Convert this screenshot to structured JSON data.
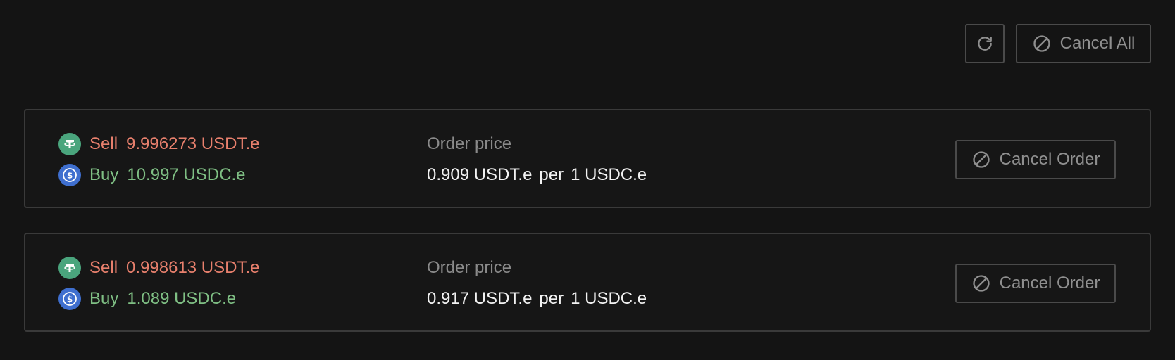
{
  "toolbar": {
    "refresh_icon": "refresh-icon",
    "cancel_all_label": "Cancel All",
    "cancel_all_icon": "ban-icon"
  },
  "colors": {
    "background": "#141414",
    "sell": "#e8806d",
    "buy": "#7fbf84",
    "muted": "#8a8a8a",
    "usdt_icon": "#4aa57d",
    "usdc_icon": "#3f6fcf"
  },
  "orders": [
    {
      "sell_label": "Sell",
      "sell_amount": "9.996273 USDT.e",
      "buy_label": "Buy",
      "buy_amount": "10.997 USDC.e",
      "price_title": "Order price",
      "price_amount": "0.909 USDT.e",
      "price_per": "per",
      "price_base": "1 USDC.e",
      "cancel_label": "Cancel Order"
    },
    {
      "sell_label": "Sell",
      "sell_amount": "0.998613 USDT.e",
      "buy_label": "Buy",
      "buy_amount": "1.089 USDC.e",
      "price_title": "Order price",
      "price_amount": "0.917 USDT.e",
      "price_per": "per",
      "price_base": "1 USDC.e",
      "cancel_label": "Cancel Order"
    }
  ]
}
